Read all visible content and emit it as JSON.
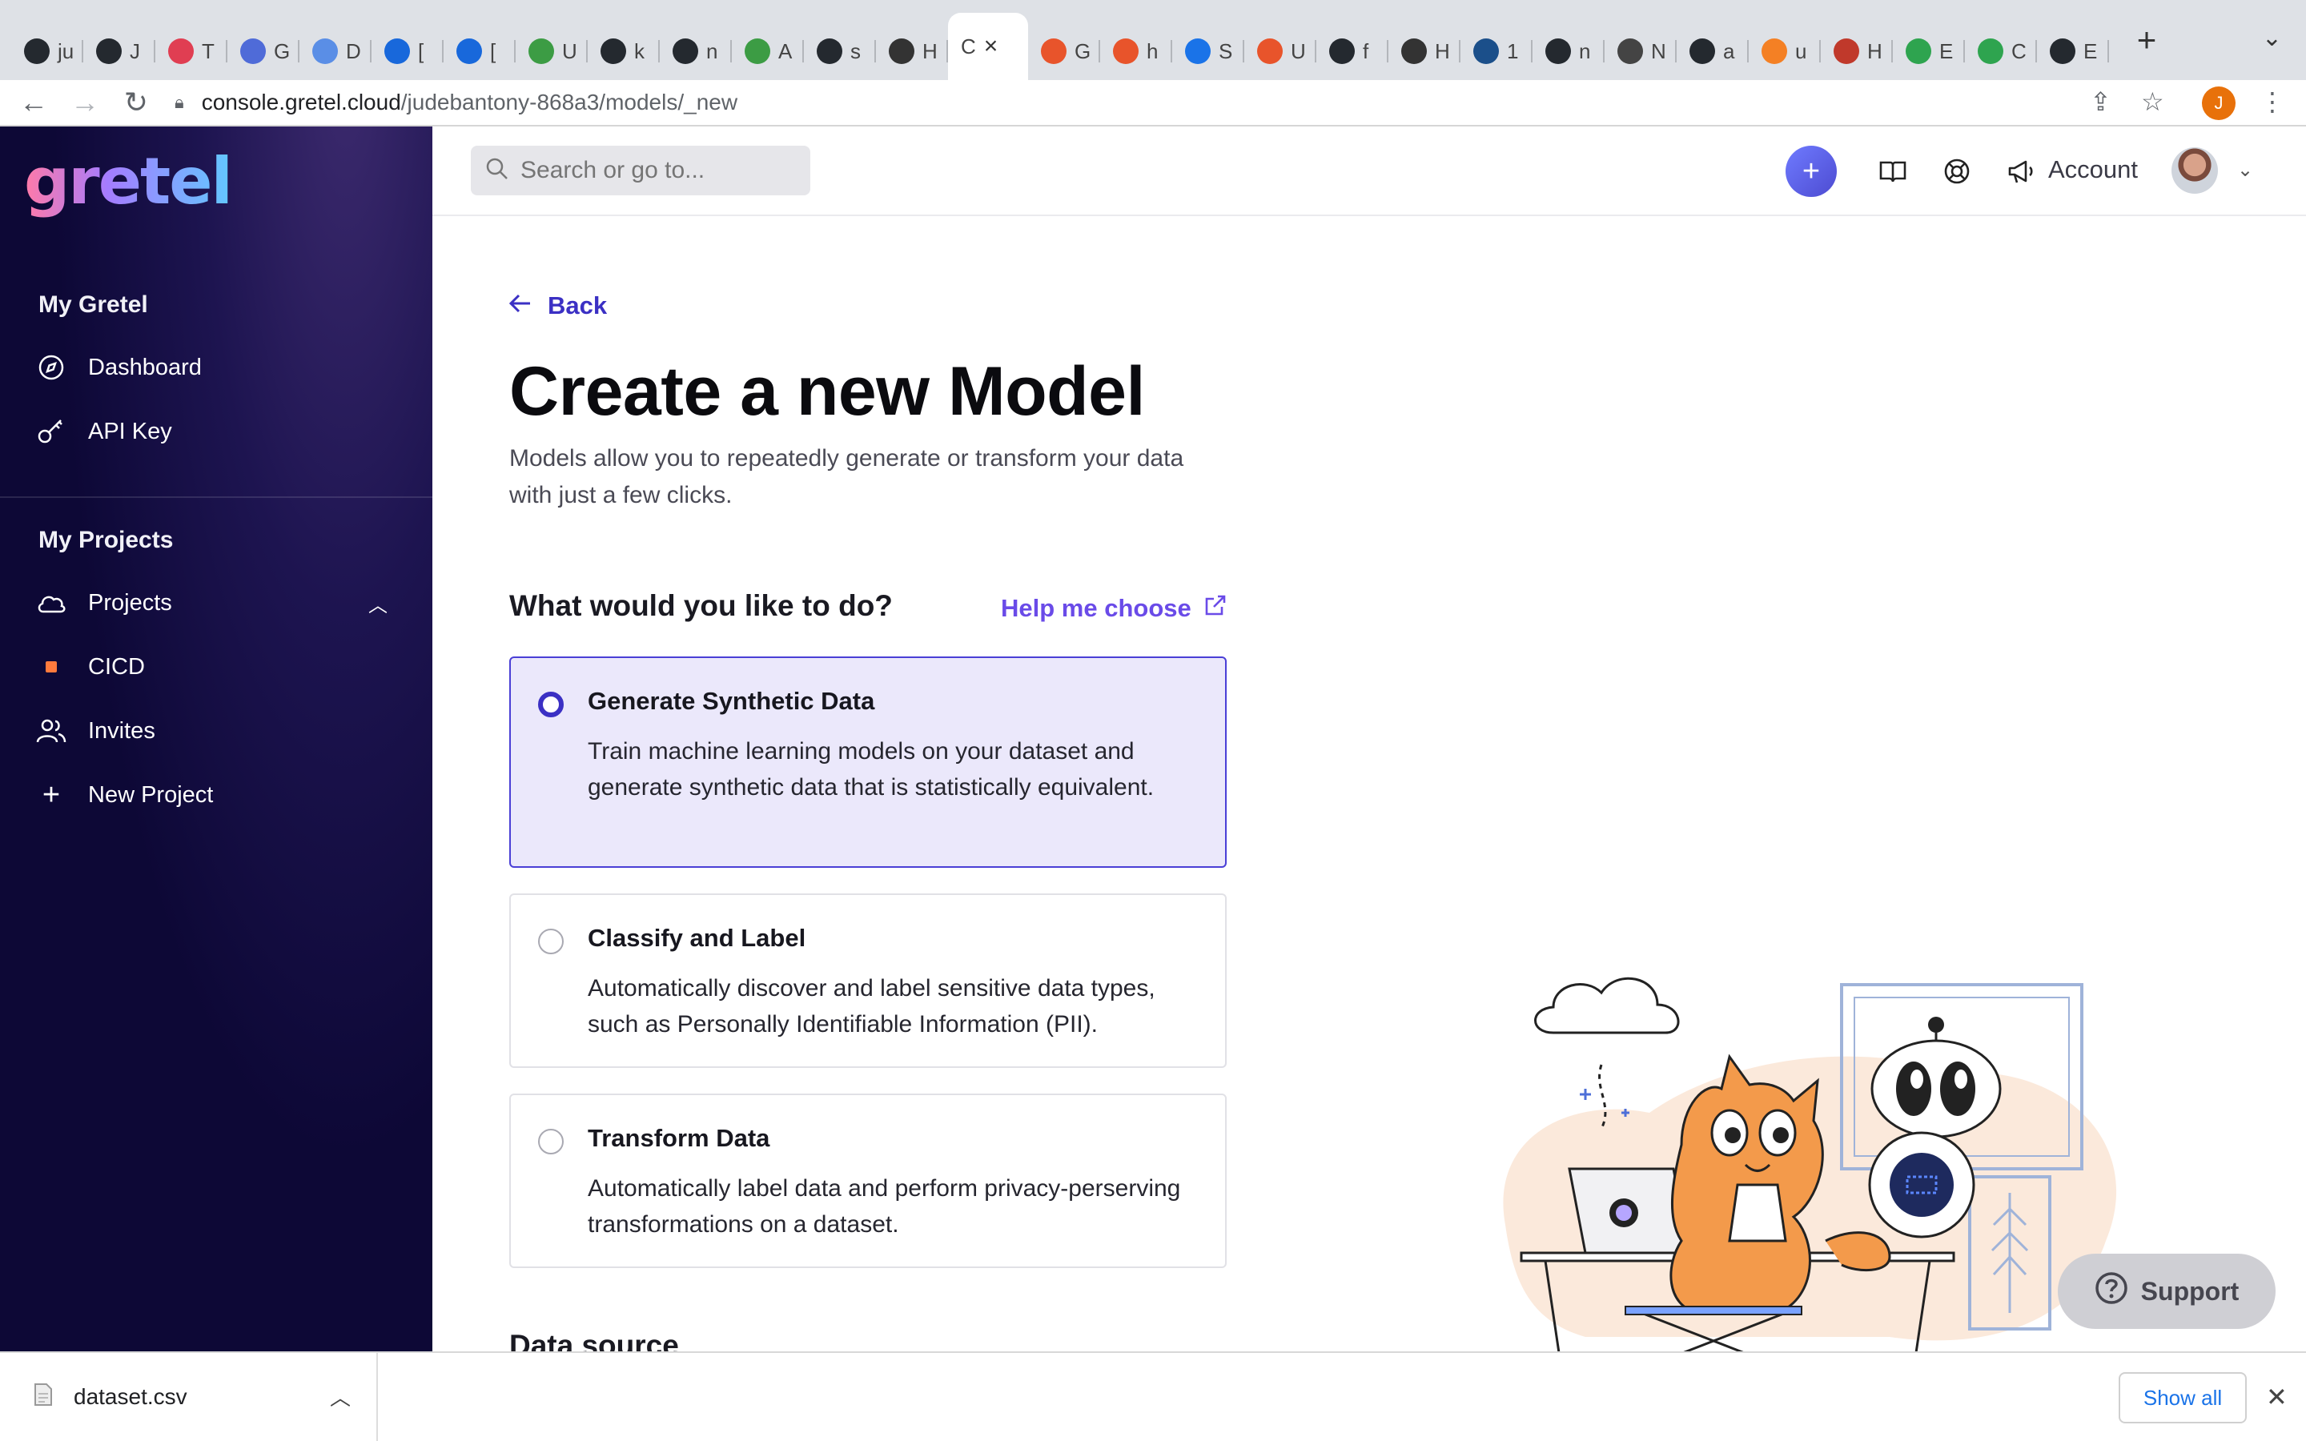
{
  "browser": {
    "tabs": [
      {
        "letter": "ju",
        "color": "#24292f",
        "icon": "github-icon"
      },
      {
        "letter": "J",
        "color": "#24292f",
        "icon": "github-icon"
      },
      {
        "letter": "T",
        "color": "#e03e52",
        "icon": "t-icon"
      },
      {
        "letter": "G",
        "color": "#4f6bd8",
        "icon": "hex-icon"
      },
      {
        "letter": "D",
        "color": "#5a8ee6",
        "icon": "d-icon"
      },
      {
        "letter": "[",
        "color": "#1868db",
        "icon": "jira-icon"
      },
      {
        "letter": "[",
        "color": "#1868db",
        "icon": "jira-icon"
      },
      {
        "letter": "U",
        "color": "#3c9c44",
        "icon": "k-icon"
      },
      {
        "letter": "k",
        "color": "#24292f",
        "icon": "github-icon"
      },
      {
        "letter": "n",
        "color": "#24292f",
        "icon": "github-icon"
      },
      {
        "letter": "A",
        "color": "#3c9c44",
        "icon": "k-icon"
      },
      {
        "letter": "s",
        "color": "#24292f",
        "icon": "github-icon"
      },
      {
        "letter": "H",
        "color": "#333333",
        "icon": "gear-icon"
      },
      {
        "letter": "G",
        "color": "#e8542b",
        "icon": "g-icon"
      },
      {
        "letter": "h",
        "color": "#e8542b",
        "icon": "h-icon"
      },
      {
        "letter": "S",
        "color": "#1a73e8",
        "icon": "k-blue-icon"
      },
      {
        "letter": "U",
        "color": "#e8542b",
        "icon": "u-icon"
      },
      {
        "letter": "f",
        "color": "#24292f",
        "icon": "github-icon"
      },
      {
        "letter": "H",
        "color": "#333333",
        "icon": "gear-icon"
      },
      {
        "letter": "1",
        "color": "#1b4f8a",
        "icon": "bird-icon"
      },
      {
        "letter": "n",
        "color": "#24292f",
        "icon": "github-icon"
      },
      {
        "letter": "N",
        "color": "#444444",
        "icon": "chrome-icon"
      },
      {
        "letter": "a",
        "color": "#24292f",
        "icon": "github-icon"
      },
      {
        "letter": "u",
        "color": "#f48024",
        "icon": "stack-icon"
      },
      {
        "letter": "H",
        "color": "#c0392b",
        "icon": "question-icon"
      },
      {
        "letter": "E",
        "color": "#2ea44f",
        "icon": "leaf-icon"
      },
      {
        "letter": "C",
        "color": "#2ea44f",
        "icon": "leaf-icon"
      },
      {
        "letter": "E",
        "color": "#24292f",
        "icon": "github-icon"
      }
    ],
    "active_tab": {
      "letter": "C",
      "index": 13
    },
    "active_letter": "C",
    "url_host": "console.gretel.cloud",
    "url_path": "/judebantony-868a3/models/_new",
    "profile_initial": "J"
  },
  "sidebar": {
    "logo": "gretel",
    "section_my_gretel": "My Gretel",
    "dashboard": "Dashboard",
    "api_key": "API Key",
    "section_my_projects": "My Projects",
    "projects": "Projects",
    "project_cicd": "CICD",
    "invites": "Invites",
    "new_project": "New Project"
  },
  "header": {
    "search_placeholder": "Search or go to...",
    "account": "Account"
  },
  "main": {
    "back": "Back",
    "title": "Create a new Model",
    "subtitle": "Models allow you to repeatedly generate or transform your data with just a few clicks.",
    "question": "What would you like to do?",
    "help_link": "Help me choose",
    "options": [
      {
        "title": "Generate Synthetic Data",
        "desc": "Train machine learning models on your dataset and generate synthetic data that is statistically equivalent.",
        "selected": true
      },
      {
        "title": "Classify and Label",
        "desc": "Automatically discover and label sensitive data types, such as Personally Identifiable Information (PII).",
        "selected": false
      },
      {
        "title": "Transform Data",
        "desc": "Automatically label data and perform privacy-perserving transformations on a dataset.",
        "selected": false
      }
    ],
    "next_section": "Data source",
    "support": "Support"
  },
  "downloads": {
    "file": "dataset.csv",
    "show_all": "Show all"
  },
  "colors": {
    "accent": "#3b30c4",
    "help_link": "#6a4be8",
    "sidebar_bg": "#0d0836",
    "selected_bg": "#ebe8fb"
  }
}
